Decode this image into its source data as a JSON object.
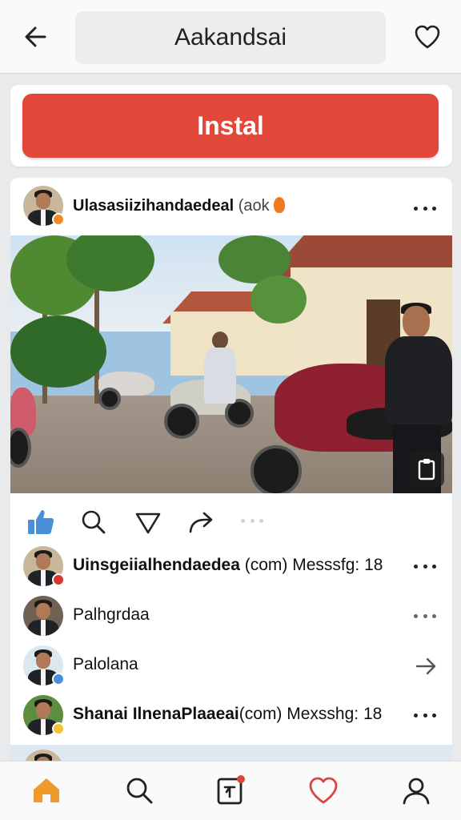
{
  "header": {
    "title": "Aakandsai",
    "back_icon": "arrow-left-icon",
    "favorite_icon": "heart-outline-icon"
  },
  "install": {
    "label": "Instal",
    "color": "#e2483a"
  },
  "post": {
    "username": "Ulasasiizihandaedeal",
    "username_suffix": "(aok",
    "more_icon": "more-horizontal-icon",
    "photo_icon": "clipboard-icon",
    "actions": [
      "like-icon",
      "search-icon",
      "heart-outline-icon",
      "share-arrow-icon"
    ],
    "like_color": "#4a90d9"
  },
  "comments": [
    {
      "name": "Uinsgeiialhendaedea",
      "rest": "(com) Messsfg: 18",
      "bold": true,
      "trailing": "dots",
      "badge_color": "#d9362e"
    },
    {
      "name": "",
      "rest": "Palhgrdaa",
      "bold": false,
      "trailing": "dots",
      "badge_color": ""
    },
    {
      "name": "",
      "rest": "Palolana",
      "bold": false,
      "trailing": "arrow",
      "badge_color": "#4a90d9"
    },
    {
      "name": "Shanai IlnenaPlaaeai",
      "rest": "(com) Mexsshg: 18",
      "bold": true,
      "trailing": "dots",
      "badge_color": "#f2c230"
    }
  ],
  "bottom_nav": {
    "items": [
      "home-icon",
      "search-icon",
      "create-post-icon",
      "heart-outline-icon",
      "profile-icon"
    ],
    "active_color": "#f09a2d",
    "heart_color": "#d9473c"
  }
}
